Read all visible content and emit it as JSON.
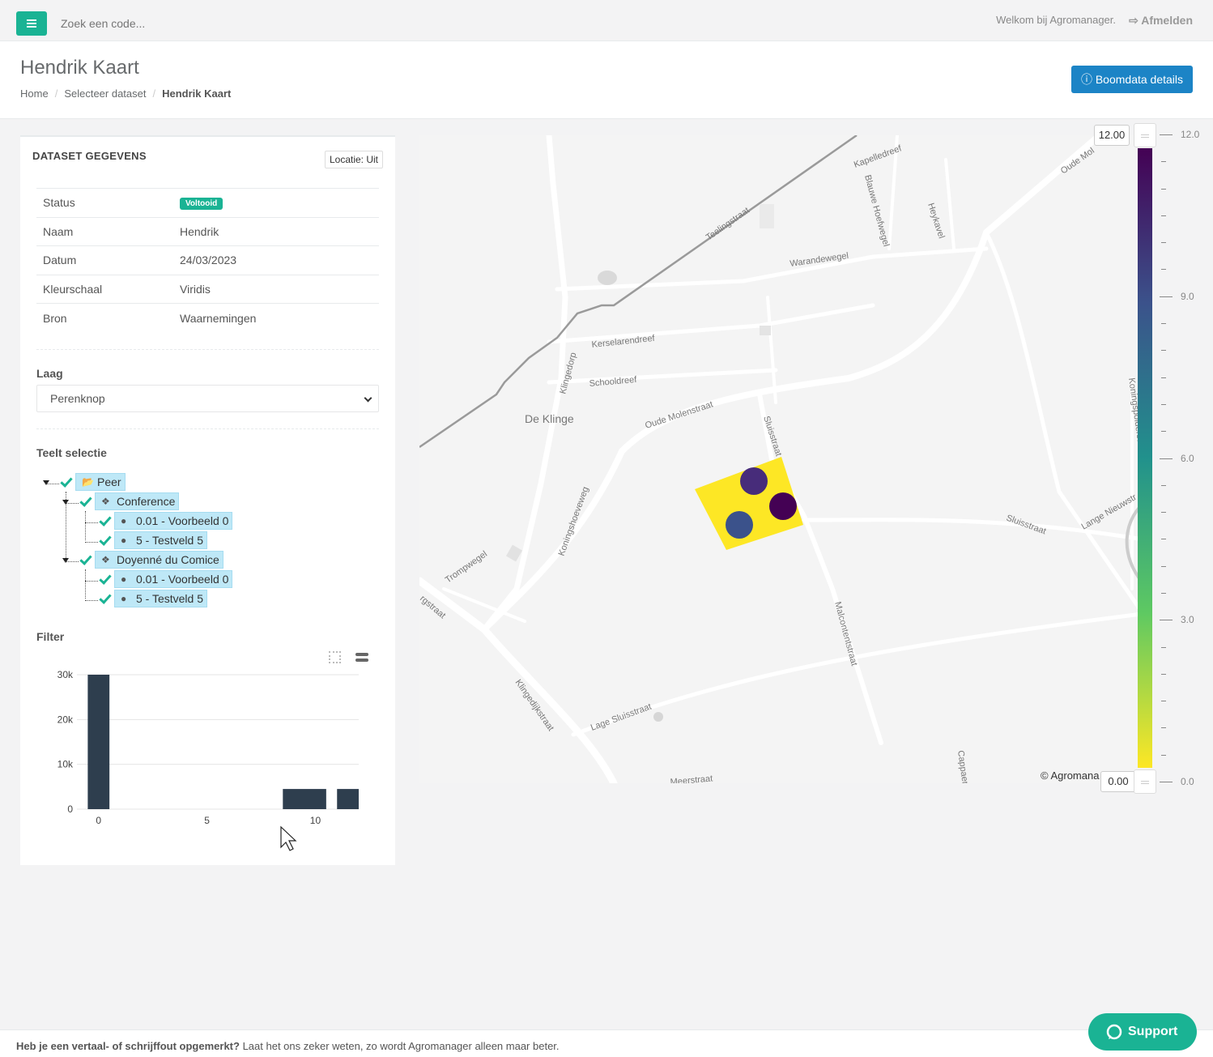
{
  "topbar": {
    "search_placeholder": "Zoek een code...",
    "welcome": "Welkom bij Agromanager.",
    "logout": "Afmelden"
  },
  "header": {
    "title": "Hendrik Kaart",
    "crumbs": [
      "Home",
      "Selecteer dataset",
      "Hendrik Kaart"
    ],
    "details_button": "Boomdata details"
  },
  "panel": {
    "title": "DATASET GEGEVENS",
    "location_button": "Locatie: Uit",
    "rows": [
      {
        "key": "Status",
        "value": "Voltooid"
      },
      {
        "key": "Naam",
        "value": "Hendrik"
      },
      {
        "key": "Datum",
        "value": "24/03/2023"
      },
      {
        "key": "Kleurschaal",
        "value": "Viridis"
      },
      {
        "key": "Bron",
        "value": "Waarnemingen"
      }
    ],
    "layer_label": "Laag",
    "layer_value": "Perenknop",
    "crop_label": "Teelt selectie",
    "tree": {
      "root": "Peer",
      "varieties": [
        {
          "name": "Conference",
          "fields": [
            "0.01 - Voorbeeld 0",
            "5 - Testveld 5"
          ]
        },
        {
          "name": "Doyenné du Comice",
          "fields": [
            "0.01 - Voorbeeld 0",
            "5 - Testveld 5"
          ]
        }
      ]
    },
    "filter_label": "Filter"
  },
  "chart_data": {
    "type": "bar",
    "title": "",
    "xlabel": "",
    "ylabel": "",
    "bins": [
      {
        "x0": 0,
        "x1": 1,
        "y": 30000
      },
      {
        "x0": 9,
        "x1": 11,
        "y": 4500
      },
      {
        "x0": 11.5,
        "x1": 12.5,
        "y": 4500
      }
    ],
    "xlim": [
      -0.5,
      12.5
    ],
    "ylim": [
      0,
      30000
    ],
    "xticks": [
      "0",
      "5",
      "10"
    ],
    "yticks": [
      "0",
      "10k",
      "20k",
      "30k"
    ]
  },
  "map": {
    "labels": [
      "Kapelledreef",
      "Blauwe Hoefwegel",
      "Heykavel",
      "Oude Mol",
      "Teelingstraat",
      "Warandewegel",
      "Kerselarendreef",
      "Schooldreef",
      "Klingedorp",
      "De Klinge",
      "Oude Molenstraat",
      "Sluisstraat",
      "Koningspolderstraat",
      "Sluisstraat",
      "Lange Nieuwstr",
      "Koningshoeveweg",
      "Trompwegel",
      "rgstraat",
      "Malcontentstraat",
      "Klingedijkstraat",
      "Lage Sluisstraat",
      "Cappaer",
      "Meerstraat"
    ],
    "attribution": "© Agromana"
  },
  "colorbar": {
    "max_box": "12.00",
    "min_box": "0.00",
    "ticks": [
      "12.0",
      "9.0",
      "6.0",
      "3.0",
      "0.0"
    ],
    "colors": [
      "#440154",
      "#3b528b",
      "#21918c",
      "#5ec962",
      "#fde725"
    ]
  },
  "footer": {
    "bold": "Heb je een vertaal- of schrijffout opgemerkt?",
    "text": " Laat het ons zeker weten, zo wordt Agromanager alleen maar beter."
  },
  "support": "Support"
}
